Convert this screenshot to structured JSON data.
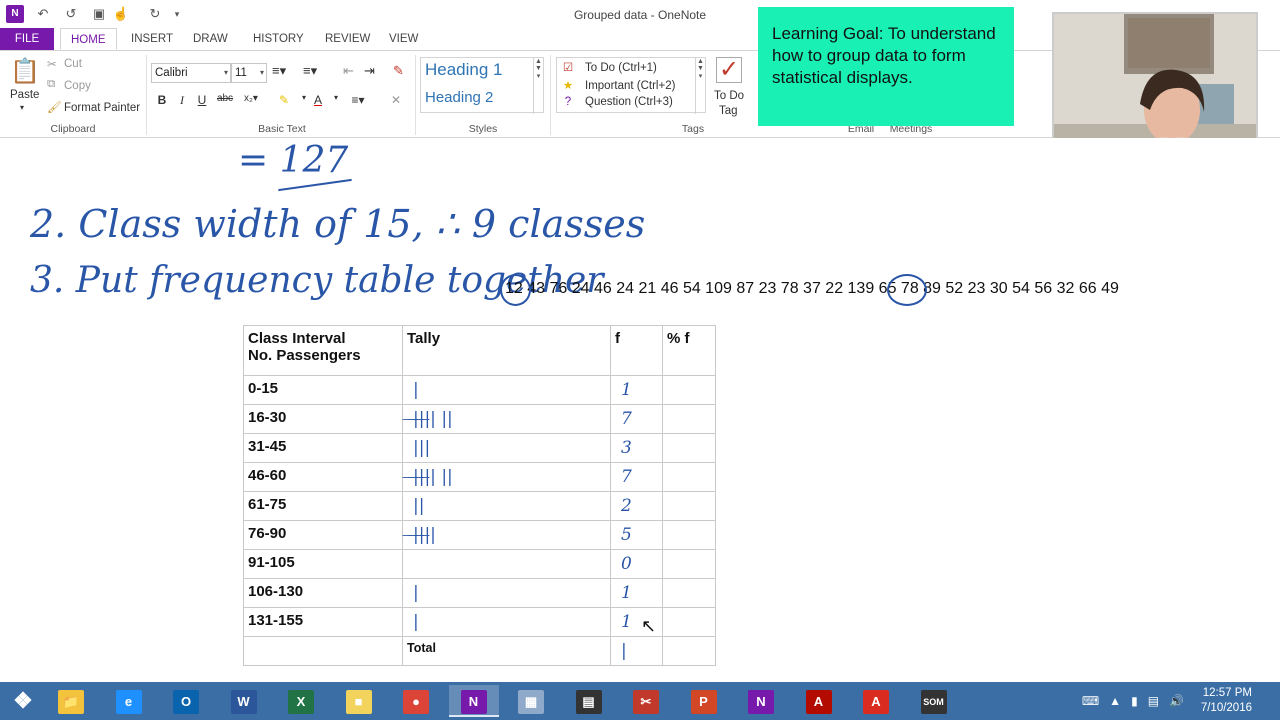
{
  "window": {
    "title": "Grouped data - OneNote",
    "app_icon": "N"
  },
  "quick_access": [
    "back-icon",
    "undo-icon",
    "dock-icon",
    "touch-mode-icon",
    "redo-icon"
  ],
  "tabs": [
    {
      "label": "FILE"
    },
    {
      "label": "HOME"
    },
    {
      "label": "INSERT"
    },
    {
      "label": "DRAW"
    },
    {
      "label": "HISTORY"
    },
    {
      "label": "REVIEW"
    },
    {
      "label": "VIEW"
    }
  ],
  "ribbon": {
    "clipboard": {
      "paste": "Paste",
      "cut": "Cut",
      "copy": "Copy",
      "format_painter": "Format Painter",
      "label": "Clipboard"
    },
    "basic_text": {
      "font": "Calibri",
      "size": "11",
      "label": "Basic Text"
    },
    "styles": {
      "heading1": "Heading 1",
      "heading2": "Heading 2",
      "label": "Styles"
    },
    "tags": {
      "items": [
        "To Do (Ctrl+1)",
        "Important (Ctrl+2)",
        "Question (Ctrl+3)"
      ],
      "todo_tag_line1": "To Do",
      "todo_tag_line2": "Tag",
      "label": "Tags"
    },
    "email_label": "Email",
    "meetings_label": "Meetings"
  },
  "learning_goal": "Learning Goal: To understand how to group data to form statistical displays.",
  "handwriting": {
    "line_total": "= 127",
    "line2": "2. Class width of 15, ∴ 9 classes",
    "line3": "3. Put frequency table together"
  },
  "data_values": "12 43 76 24 46 24 21 46 54 109 87 23 78 37 22 139 65 78 89 52 23 30 54 56 32 66 49",
  "table": {
    "headers": {
      "interval_line1": "Class Interval",
      "interval_line2": "No. Passengers",
      "tally": "Tally",
      "f": "f",
      "pct": "% f"
    },
    "rows": [
      {
        "interval": "0-15",
        "tally": "|",
        "f": "1"
      },
      {
        "interval": "16-30",
        "tally": "̶|̶|̶|̶| ||",
        "f": "7"
      },
      {
        "interval": "31-45",
        "tally": "|||",
        "f": "3"
      },
      {
        "interval": "46-60",
        "tally": "̶|̶|̶|̶| ||",
        "f": "7"
      },
      {
        "interval": "61-75",
        "tally": "||",
        "f": "2"
      },
      {
        "interval": "76-90",
        "tally": "̶|̶|̶|̶|",
        "f": "5"
      },
      {
        "interval": "91-105",
        "tally": "",
        "f": "0"
      },
      {
        "interval": "106-130",
        "tally": "|",
        "f": "1"
      },
      {
        "interval": "131-155",
        "tally": "|",
        "f": "1"
      }
    ],
    "total_label": "Total",
    "total_value": "|"
  },
  "taskbar": {
    "apps": [
      {
        "name": "file-explorer-icon",
        "glyph": "📁",
        "color": "#f3c33e"
      },
      {
        "name": "internet-explorer-icon",
        "glyph": "e",
        "color": "#1e90ff"
      },
      {
        "name": "outlook-icon",
        "glyph": "O",
        "color": "#0a64ad"
      },
      {
        "name": "word-icon",
        "glyph": "W",
        "color": "#2b579a"
      },
      {
        "name": "excel-icon",
        "glyph": "X",
        "color": "#217346"
      },
      {
        "name": "sticky-notes-icon",
        "glyph": "■",
        "color": "#f2d45c"
      },
      {
        "name": "chrome-icon",
        "glyph": "●",
        "color": "#db4437"
      },
      {
        "name": "onenote-icon",
        "glyph": "N",
        "color": "#7719aa"
      },
      {
        "name": "calculator-icon",
        "glyph": "▦",
        "color": "#8ea9c9"
      },
      {
        "name": "scientific-calculator-icon",
        "glyph": "▤",
        "color": "#333"
      },
      {
        "name": "snipping-tool-icon",
        "glyph": "✂",
        "color": "#c0392b"
      },
      {
        "name": "powerpoint-icon",
        "glyph": "P",
        "color": "#d24726"
      },
      {
        "name": "onenote-clip-icon",
        "glyph": "N",
        "color": "#7719aa"
      },
      {
        "name": "acrobat-icon",
        "glyph": "A",
        "color": "#b30b00"
      },
      {
        "name": "acrobat-reader-icon",
        "glyph": "A",
        "color": "#d92b1f"
      },
      {
        "name": "screencast-icon",
        "glyph": "SOM",
        "color": "#333"
      }
    ],
    "time": "12:57 PM",
    "date": "7/10/2016"
  }
}
